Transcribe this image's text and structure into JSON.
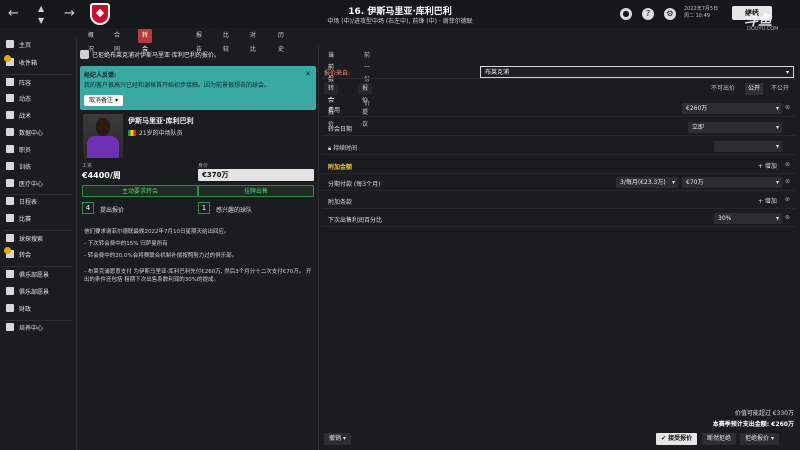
{
  "header": {
    "player_title": "16. 伊斯马里亚·库利巴利",
    "player_sub": "中场 (中)/进攻型中场 (右左中), 前锋 (中) · 谢菲尔德联",
    "date_line1": "2022年7月5日",
    "date_line2": "周二 10:49",
    "continue_label": "继续",
    "watermark": "斗鱼",
    "watermark_sub": "DOUYU.COM"
  },
  "subnav": {
    "items": [
      "概况",
      "合同",
      "转会",
      "报告",
      "比较",
      "对比",
      "历史"
    ],
    "active": "转会"
  },
  "sidebar": {
    "items": [
      {
        "label": "主页",
        "icon": "home-icon"
      },
      {
        "label": "收件箱",
        "icon": "inbox-icon",
        "badge": true
      },
      {
        "label": "阵容",
        "icon": "squad-icon"
      },
      {
        "label": "动态",
        "icon": "dynamics-icon"
      },
      {
        "label": "战术",
        "icon": "tactics-icon"
      },
      {
        "label": "数据中心",
        "icon": "data-hub-icon"
      },
      {
        "label": "职员",
        "icon": "staff-icon"
      },
      {
        "label": "训练",
        "icon": "training-icon"
      },
      {
        "label": "医疗中心",
        "icon": "medical-icon"
      },
      {
        "label": "日程表",
        "icon": "calendar-icon"
      },
      {
        "label": "比赛",
        "icon": "competitions-icon"
      },
      {
        "label": "球探搜索",
        "icon": "scouting-icon"
      },
      {
        "label": "转会",
        "icon": "transfers-icon",
        "badge": true
      },
      {
        "label": "俱乐部愿景",
        "icon": "club-vision-icon"
      },
      {
        "label": "俱乐部愿景",
        "icon": "club-vision-icon"
      },
      {
        "label": "财政",
        "icon": "finances-icon"
      },
      {
        "label": "培养中心",
        "icon": "development-icon"
      }
    ]
  },
  "note": "已拒绝布莱克浦对伊斯马里亚·库利巴利的报价。",
  "feedback": {
    "title": "经纪人反馈:",
    "text": "我的客户很高兴已经和谢格首开始初步接触。因为前景很想去的球会。",
    "button": "取消备注"
  },
  "profile": {
    "name": "伊斯马里亚·库利巴利",
    "role": "21岁的中场队员",
    "wage_label": "工资",
    "wage": "€4400/周",
    "value_label": "身价",
    "value": "€370万",
    "btn_left": "主动要求转会",
    "btn_right": "挂牌出售",
    "offers_count": "4",
    "offers_label": "提出报价",
    "interest_count": "1",
    "interest_label": "感兴趣的球队"
  },
  "description": [
    "他们要求谢菲尔德联最晚2022年7月10日星期天给出回应。",
    "- 下次转会费中的15% 归萨曼所有",
    "- 转会费中的20.0%会将赛联合机制补偿按照努力过的俱乐部。",
    "- 布莱克浦愿意支付 为伊斯马里亚·库利巴利先付€260万, 然后3个月分十二次支付€70万。 开出的条件还包括 租期下次出售系数利润的30%的提成。"
  ],
  "right": {
    "tabs": [
      "当前报价",
      "前一份报价"
    ],
    "from_label": "报价来自:",
    "from_value": "布莱克浦",
    "sec_tabs": [
      "转会报价",
      "报价提议"
    ],
    "not_tradable": "不可出价",
    "public": "公开",
    "not_public": "不公开",
    "rows": {
      "fee_label": "费用",
      "fee_value": "€260万",
      "date_label": "转会日期",
      "date_value": "立即",
      "sell_on_label": "持续时间",
      "extras_label": "附加金额",
      "add_label": "+ 增加",
      "installments_label": "分期付款 (每3个月)",
      "installments_value": "3/每月(€23.3万)",
      "installments_amount": "€70万",
      "clauses_label": "附加条款",
      "next_sale_label": "下次出售利润百分比",
      "next_sale_value": "30%"
    },
    "value_worth": "价值可能超过 €330万",
    "expected_total": "本赛季预计支出金额: €260万",
    "bottom_left": "撤销",
    "accept": "接受报价",
    "counter": "断然拒绝",
    "reject": "拒绝报价"
  }
}
